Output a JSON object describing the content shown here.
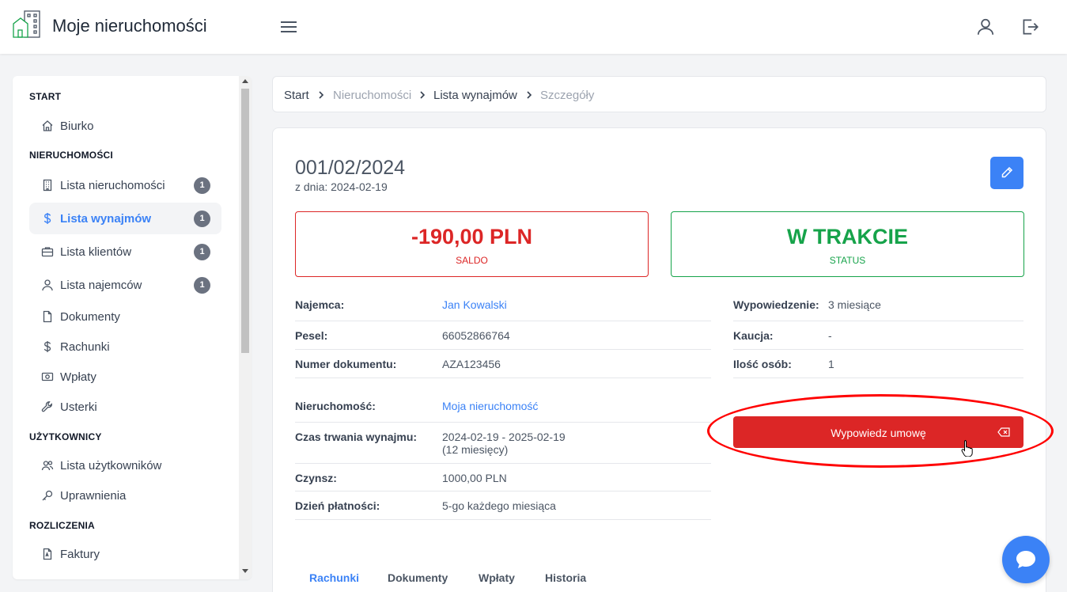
{
  "header": {
    "title": "Moje nieruchomości"
  },
  "sidebar": {
    "sections": {
      "start": "START",
      "properties": "NIERUCHOMOŚCI",
      "users": "UŻYTKOWNICY",
      "billing": "ROZLICZENIA"
    },
    "items": [
      {
        "label": "Biurko",
        "icon": "home-icon"
      },
      {
        "label": "Lista nieruchomości",
        "icon": "building-icon",
        "badge": "1"
      },
      {
        "label": "Lista wynajmów",
        "icon": "dollar-icon",
        "badge": "1",
        "active": true
      },
      {
        "label": "Lista klientów",
        "icon": "briefcase-icon",
        "badge": "1"
      },
      {
        "label": "Lista najemców",
        "icon": "user-icon",
        "badge": "1"
      },
      {
        "label": "Dokumenty",
        "icon": "document-icon"
      },
      {
        "label": "Rachunki",
        "icon": "dollar-icon"
      },
      {
        "label": "Wpłaty",
        "icon": "cash-icon"
      },
      {
        "label": "Usterki",
        "icon": "wrench-icon"
      },
      {
        "label": "Lista użytkowników",
        "icon": "users-icon"
      },
      {
        "label": "Uprawnienia",
        "icon": "key-icon"
      },
      {
        "label": "Faktury",
        "icon": "invoice-icon"
      }
    ]
  },
  "breadcrumb": [
    "Start",
    "Nieruchomości",
    "Lista wynajmów",
    "Szczegóły"
  ],
  "rental": {
    "number": "001/02/2024",
    "date": "z dnia: 2024-02-19",
    "balance": "-190,00 PLN",
    "balance_label": "SALDO",
    "status": "W TRAKCIE",
    "status_label": "STATUS"
  },
  "details_left": [
    {
      "key": "Najemca:",
      "value": "Jan Kowalski"
    },
    {
      "key": "Pesel:",
      "value": "66052866764"
    },
    {
      "key": "Numer dokumentu:",
      "value": "AZA123456"
    }
  ],
  "details_right": [
    {
      "key": "Wypowiedzenie:",
      "value": "3 miesiące"
    },
    {
      "key": "Kaucja:",
      "value": "-"
    },
    {
      "key": "Ilość osób:",
      "value": "1"
    }
  ],
  "property_details": [
    {
      "key": "Nieruchomość:",
      "value": "Moja nieruchomość"
    },
    {
      "key": "Czas trwania wynajmu:",
      "value": "2024-02-19 - 2025-02-19",
      "value2": "(12 miesięcy)"
    },
    {
      "key": "Czynsz:",
      "value": "1000,00 PLN"
    },
    {
      "key": "Dzień płatności:",
      "value": "5-go każdego miesiąca"
    }
  ],
  "actions": {
    "terminate": "Wypowiedz umowę"
  },
  "tabs": [
    "Rachunki",
    "Dokumenty",
    "Wpłaty",
    "Historia"
  ],
  "colors": {
    "accent": "#3b82f6",
    "danger": "#dc2626",
    "success": "#16a34a"
  }
}
